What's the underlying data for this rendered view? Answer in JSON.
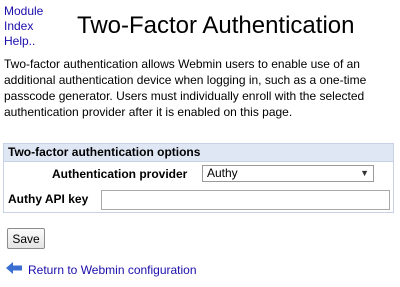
{
  "module_links": {
    "module": "Module",
    "index": "Index",
    "help": "Help.."
  },
  "header": {
    "title": "Two-Factor Authentication"
  },
  "intro": {
    "text": "Two-factor authentication allows Webmin users to enable use of an additional authentication device when logging in, such as a one-time passcode generator. Users must individually enroll with the selected authentication provider after it is enabled on this page."
  },
  "options_panel": {
    "title": "Two-factor authentication options",
    "provider_label": "Authentication provider",
    "provider_value": "Authy",
    "api_key_label": "Authy API key",
    "api_key_value": ""
  },
  "actions": {
    "save_label": "Save"
  },
  "footer": {
    "return_label": "Return to Webmin configuration"
  },
  "colors": {
    "link": "#1a0dab",
    "panel_header_bg": "#dfe7f5",
    "arrow": "#3a6fd1"
  },
  "icons": {
    "return": "left-arrow-icon",
    "dropdown": "chevron-down-icon"
  }
}
